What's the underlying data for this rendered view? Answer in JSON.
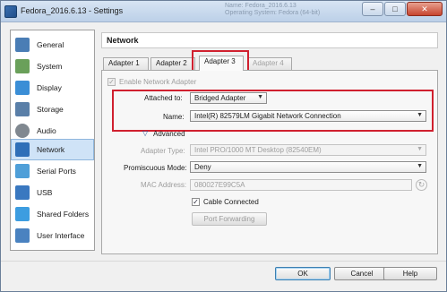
{
  "window": {
    "title": "Fedora_2016.6.13 - Settings",
    "ghost_info": [
      "Name:              Fedora_2016.6.13",
      "Operating System:  Fedora (64-bit)"
    ],
    "controls": {
      "minimize": "–",
      "maximize": "□",
      "close": "✕"
    }
  },
  "sidebar": {
    "items": [
      {
        "label": "General",
        "icon": "general-icon",
        "color": "#4a7db5"
      },
      {
        "label": "System",
        "icon": "system-icon",
        "color": "#6aa05a"
      },
      {
        "label": "Display",
        "icon": "display-icon",
        "color": "#3b8ed6"
      },
      {
        "label": "Storage",
        "icon": "storage-icon",
        "color": "#5a7fa8"
      },
      {
        "label": "Audio",
        "icon": "audio-icon",
        "color": "#808890"
      },
      {
        "label": "Network",
        "icon": "network-icon",
        "color": "#2f6fb8"
      },
      {
        "label": "Serial Ports",
        "icon": "serial-ports-icon",
        "color": "#4f9fd8"
      },
      {
        "label": "USB",
        "icon": "usb-icon",
        "color": "#3a78c0"
      },
      {
        "label": "Shared Folders",
        "icon": "shared-folders-icon",
        "color": "#3d9de0"
      },
      {
        "label": "User Interface",
        "icon": "user-interface-icon",
        "color": "#4a82c0"
      }
    ],
    "active": "Network"
  },
  "section": {
    "title": "Network"
  },
  "tabs": [
    "Adapter 1",
    "Adapter 2",
    "Adapter 3",
    "Adapter 4"
  ],
  "active_tab": "Adapter 3",
  "form": {
    "enable_label": "Enable Network Adapter",
    "attached_label": "Attached to:",
    "attached_value": "Bridged Adapter",
    "name_label": "Name:",
    "name_value": "Intel(R) 82579LM Gigabit Network Connection",
    "advanced_label": "Advanced",
    "adapter_type_label": "Adapter Type:",
    "adapter_type_value": "Intel PRO/1000 MT Desktop (82540EM)",
    "promiscuous_label": "Promiscuous Mode:",
    "promiscuous_value": "Deny",
    "mac_label": "MAC Address:",
    "mac_value": "080027E99C5A",
    "cable_label": "Cable Connected",
    "port_forwarding_label": "Port Forwarding"
  },
  "footer": {
    "ok": "OK",
    "cancel": "Cancel",
    "help": "Help"
  },
  "colors": {
    "highlight": "#d0202f",
    "selection": "#cfe3f7"
  }
}
